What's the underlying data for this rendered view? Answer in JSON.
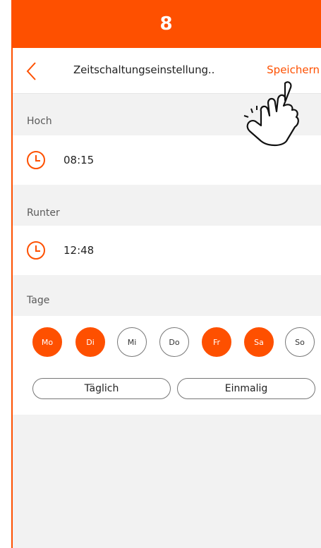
{
  "step_number": "8",
  "header": {
    "title": "Zeitschaltungseinstellung..",
    "save_label": "Speichern",
    "back_icon": "chevron-left-icon"
  },
  "sections": {
    "up": {
      "label": "Hoch",
      "time": "08:15",
      "icon": "clock-icon"
    },
    "down": {
      "label": "Runter",
      "time": "12:48",
      "icon": "clock-icon"
    },
    "days": {
      "label": "Tage",
      "items": [
        {
          "label": "Mo",
          "selected": true
        },
        {
          "label": "Di",
          "selected": true
        },
        {
          "label": "Mi",
          "selected": false
        },
        {
          "label": "Do",
          "selected": false
        },
        {
          "label": "Fr",
          "selected": true
        },
        {
          "label": "Sa",
          "selected": true
        },
        {
          "label": "So",
          "selected": false
        }
      ]
    }
  },
  "repeat": {
    "daily_label": "Täglich",
    "once_label": "Einmalig"
  },
  "colors": {
    "accent": "#fe5000",
    "background": "#f2f2f2",
    "surface": "#ffffff"
  },
  "pointer": "tap-hand-icon"
}
